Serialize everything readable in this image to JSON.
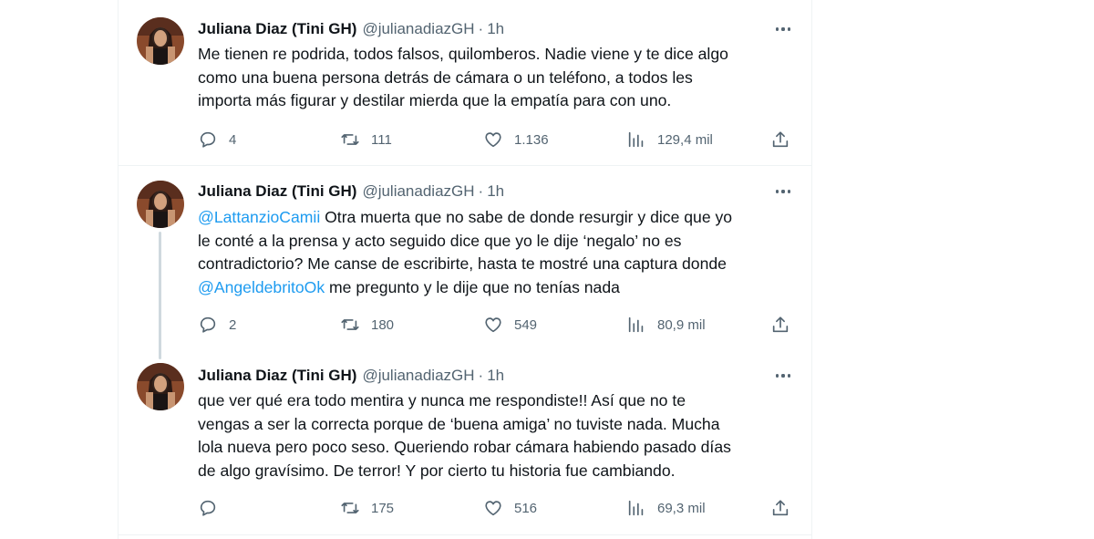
{
  "tweets": [
    {
      "name": "Juliana Diaz (Tini GH)",
      "handle": "@julianadiazGH",
      "separator": "·",
      "time": "1h",
      "text": "Me tienen re podrida, todos falsos, quilomberos. Nadie viene y te dice algo\ncomo una buena persona detrás de cámara o un teléfono, a todos les\nimporta más figurar y destilar mierda que la empatía para con uno.",
      "replies": "4",
      "retweets": "111",
      "likes": "1.136",
      "views": "129,4 mil"
    },
    {
      "name": "Juliana Diaz (Tini GH)",
      "handle": "@julianadiazGH",
      "separator": "·",
      "time": "1h",
      "mention1": "@LattanzioCamii",
      "text_a": " Otra muerta que no sabe de donde resurgir y dice que yo\nle conté a la prensa y acto seguido dice que yo le dije ‘negalo’ no es\ncontradictorio? Me canse de escribirte, hasta te mostré una captura donde\n",
      "mention2": "@AngeldebritoOk",
      "text_b": " me pregunto y le dije que no tenías nada",
      "replies": "2",
      "retweets": "180",
      "likes": "549",
      "views": "80,9 mil"
    },
    {
      "name": "Juliana Diaz (Tini GH)",
      "handle": "@julianadiazGH",
      "separator": "·",
      "time": "1h",
      "text": "que ver qué era todo mentira y nunca me respondiste!! Así que no te\nvengas a ser la correcta porque de ‘buena amiga’ no tuviste nada. Mucha\nlola nueva pero poco seso. Queriendo robar cámara habiendo pasado días\nde algo gravísimo. De terror! Y por cierto tu historia fue cambiando.",
      "replies": "",
      "retweets": "175",
      "likes": "516",
      "views": "69,3 mil"
    }
  ],
  "icons": [
    "reply-icon",
    "retweet-icon",
    "like-icon",
    "views-icon",
    "share-icon",
    "more-icon"
  ],
  "colors": {
    "text": "#0f1419",
    "secondary": "#536471",
    "link": "#1d9bf0",
    "border": "#eff3f4",
    "thread": "#cfd9de"
  }
}
